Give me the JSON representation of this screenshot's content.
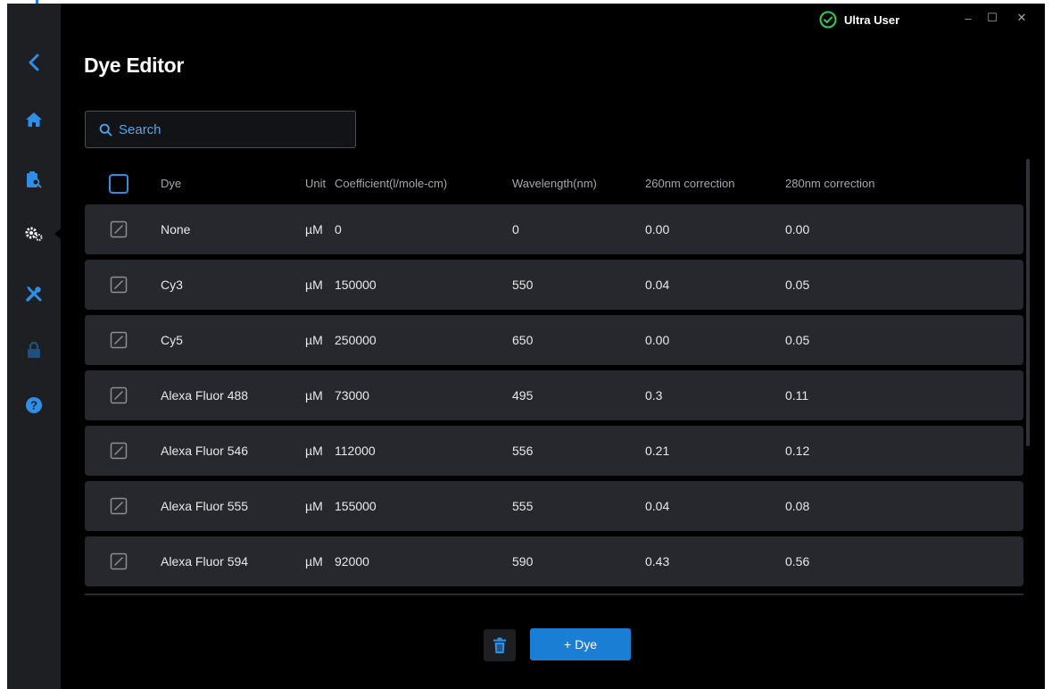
{
  "app": {
    "user": "Ultra User",
    "window_controls": {
      "minimize": "–",
      "maximize": "☐",
      "close": "✕"
    }
  },
  "colors": {
    "accent": "#1a7fd4",
    "ok": "#2fcf52",
    "background": "#000000",
    "row": "#27282d",
    "sidebar": "#1e1f23"
  },
  "sidebar": {
    "items": [
      {
        "icon": "back-chevron-icon"
      },
      {
        "icon": "home-icon"
      },
      {
        "icon": "clipboard-search-icon"
      },
      {
        "icon": "gears-icon",
        "active": true
      },
      {
        "icon": "tools-icon"
      },
      {
        "icon": "lock-icon"
      },
      {
        "icon": "help-icon"
      }
    ]
  },
  "page": {
    "title": "Dye Editor",
    "search_placeholder": "Search"
  },
  "table": {
    "columns": [
      "Dye",
      "Unit",
      "Coefficient(l/mole-cm)",
      "Wavelength(nm)",
      "260nm correction",
      "280nm correction"
    ],
    "rows": [
      {
        "dye": "None",
        "unit": "µM",
        "coefficient": "0",
        "wavelength": "0",
        "corr260": "0.00",
        "corr280": "0.00"
      },
      {
        "dye": "Cy3",
        "unit": "µM",
        "coefficient": "150000",
        "wavelength": "550",
        "corr260": "0.04",
        "corr280": "0.05"
      },
      {
        "dye": "Cy5",
        "unit": "µM",
        "coefficient": "250000",
        "wavelength": "650",
        "corr260": "0.00",
        "corr280": "0.05"
      },
      {
        "dye": "Alexa Fluor 488",
        "unit": "µM",
        "coefficient": "73000",
        "wavelength": "495",
        "corr260": "0.3",
        "corr280": "0.11"
      },
      {
        "dye": "Alexa Fluor 546",
        "unit": "µM",
        "coefficient": "112000",
        "wavelength": "556",
        "corr260": "0.21",
        "corr280": "0.12"
      },
      {
        "dye": "Alexa Fluor 555",
        "unit": "µM",
        "coefficient": "155000",
        "wavelength": "555",
        "corr260": "0.04",
        "corr280": "0.08"
      },
      {
        "dye": "Alexa Fluor 594",
        "unit": "µM",
        "coefficient": "92000",
        "wavelength": "590",
        "corr260": "0.43",
        "corr280": "0.56"
      }
    ]
  },
  "footer": {
    "delete_icon": "trash-icon",
    "add_label": "+ Dye"
  }
}
